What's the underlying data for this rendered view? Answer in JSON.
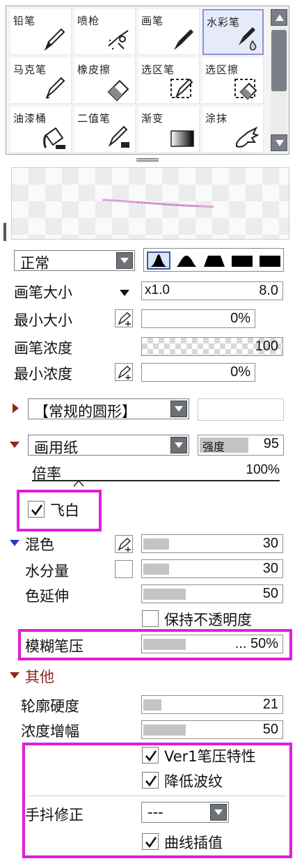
{
  "tools": [
    {
      "label": "铅笔",
      "icon": "pencil-icon"
    },
    {
      "label": "喷枪",
      "icon": "airbrush-icon"
    },
    {
      "label": "画笔",
      "icon": "brush-icon"
    },
    {
      "label": "水彩笔",
      "icon": "watercolor-brush-icon",
      "selected": true
    },
    {
      "label": "马克笔",
      "icon": "marker-icon"
    },
    {
      "label": "橡皮擦",
      "icon": "eraser-icon"
    },
    {
      "label": "选区笔",
      "icon": "selection-pen-icon"
    },
    {
      "label": "选区擦",
      "icon": "selection-eraser-icon"
    },
    {
      "label": "油漆桶",
      "icon": "paint-bucket-icon"
    },
    {
      "label": "二值笔",
      "icon": "binary-pen-icon"
    },
    {
      "label": "渐变",
      "icon": "gradient-icon"
    },
    {
      "label": "涂抹",
      "icon": "smudge-icon"
    }
  ],
  "blend_mode": "正常",
  "brush_size": {
    "label": "画笔大小",
    "multiplier": "x1.0",
    "value": "8.0"
  },
  "min_size": {
    "label": "最小大小",
    "value": "0%"
  },
  "brush_density": {
    "label": "画笔浓度",
    "value": "100"
  },
  "min_density": {
    "label": "最小浓度",
    "value": "0%"
  },
  "brush_shape": {
    "value": "【常规的圆形】"
  },
  "paper": {
    "value": "画用纸",
    "strength_label": "强度",
    "strength": "95"
  },
  "ratio": {
    "label": "倍率",
    "value": "100%",
    "percent": 100
  },
  "dry_brush": {
    "label": "飞白",
    "checked": true
  },
  "mix": {
    "label": "混色",
    "value": "30",
    "percent": 30
  },
  "water": {
    "label": "水分量",
    "value": "30",
    "percent": 30
  },
  "color_extend": {
    "label": "色延伸",
    "value": "50",
    "percent": 50
  },
  "keep_opacity": {
    "label": "保持不透明度",
    "checked": false
  },
  "blur_pressure": {
    "label": "模糊笔压",
    "value": "... 50%",
    "percent": 50
  },
  "other_section": {
    "label": "其他"
  },
  "edge_hardness": {
    "label": "轮廓硬度",
    "value": "21",
    "percent": 21
  },
  "density_gain": {
    "label": "浓度增幅",
    "value": "50",
    "percent": 50
  },
  "ver1_pressure": {
    "label": "Ver1笔压特性",
    "checked": true
  },
  "reduce_moire": {
    "label": "降低波纹",
    "checked": true
  },
  "stabilizer": {
    "label": "手抖修正",
    "value": "---"
  },
  "curve_interp": {
    "label": "曲线插值",
    "checked": true
  },
  "colors": {
    "highlight": "#e21cd8",
    "selected_tool": "#8c93d6",
    "section_arrow": "#8b2a1a",
    "mix_arrow": "#2a36c8"
  }
}
